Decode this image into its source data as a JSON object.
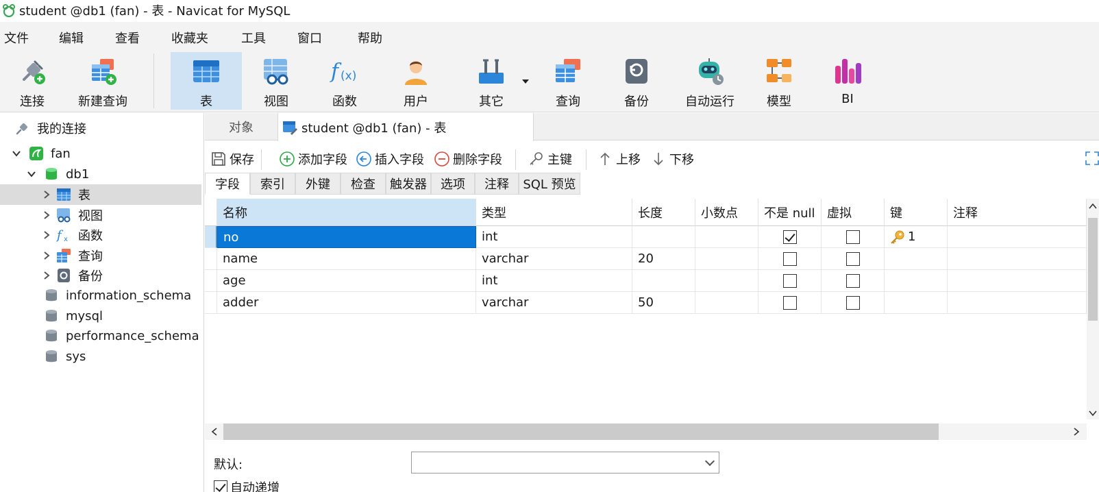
{
  "window": {
    "title": "student @db1 (fan) - 表 - Navicat for MySQL"
  },
  "menu": [
    "文件",
    "编辑",
    "查看",
    "收藏夹",
    "工具",
    "窗口",
    "帮助"
  ],
  "toolbar": [
    {
      "label": "连接",
      "icon": "connect-plug-icon"
    },
    {
      "label": "新建查询",
      "icon": "new-query-icon"
    },
    {
      "label": "表",
      "icon": "table-icon",
      "active": true
    },
    {
      "label": "视图",
      "icon": "view-icon"
    },
    {
      "label": "函数",
      "icon": "function-icon"
    },
    {
      "label": "用户",
      "icon": "user-icon"
    },
    {
      "label": "其它",
      "icon": "tools-icon"
    },
    {
      "label": "查询",
      "icon": "query-icon"
    },
    {
      "label": "备份",
      "icon": "backup-icon"
    },
    {
      "label": "自动运行",
      "icon": "robot-icon"
    },
    {
      "label": "模型",
      "icon": "model-icon"
    },
    {
      "label": "BI",
      "icon": "bi-icon"
    }
  ],
  "tree": {
    "root": "我的连接",
    "connection": "fan",
    "database": "db1",
    "db_children": [
      "表",
      "视图",
      "函数",
      "查询",
      "备份"
    ],
    "other_dbs": [
      "information_schema",
      "mysql",
      "performance_schema",
      "sys"
    ]
  },
  "tabs": {
    "objects": "对象",
    "current": "student @db1 (fan) - 表"
  },
  "actions": {
    "save": "保存",
    "add_field": "添加字段",
    "insert_field": "插入字段",
    "delete_field": "删除字段",
    "primary_key": "主键",
    "move_up": "上移",
    "move_down": "下移"
  },
  "subtabs": [
    "字段",
    "索引",
    "外键",
    "检查",
    "触发器",
    "选项",
    "注释",
    "SQL 预览"
  ],
  "grid": {
    "columns": [
      "名称",
      "类型",
      "长度",
      "小数点",
      "不是 null",
      "虚拟",
      "键",
      "注释"
    ],
    "rows": [
      {
        "name": "no",
        "type": "int",
        "length": "",
        "decimals": "",
        "not_null": true,
        "virtual": false,
        "key": "1",
        "comment": ""
      },
      {
        "name": "name",
        "type": "varchar",
        "length": "20",
        "decimals": "",
        "not_null": false,
        "virtual": false,
        "key": "",
        "comment": ""
      },
      {
        "name": "age",
        "type": "int",
        "length": "",
        "decimals": "",
        "not_null": false,
        "virtual": false,
        "key": "",
        "comment": ""
      },
      {
        "name": "adder",
        "type": "varchar",
        "length": "50",
        "decimals": "",
        "not_null": false,
        "virtual": false,
        "key": "",
        "comment": ""
      }
    ]
  },
  "props": {
    "default_label": "默认:",
    "default_value": "",
    "auto_increment_label": "自动递增",
    "auto_increment": true
  },
  "colors": {
    "accent": "#0a78d7",
    "selected_header": "#cde4f7",
    "toolbar_bg": "#f3f3f3"
  }
}
